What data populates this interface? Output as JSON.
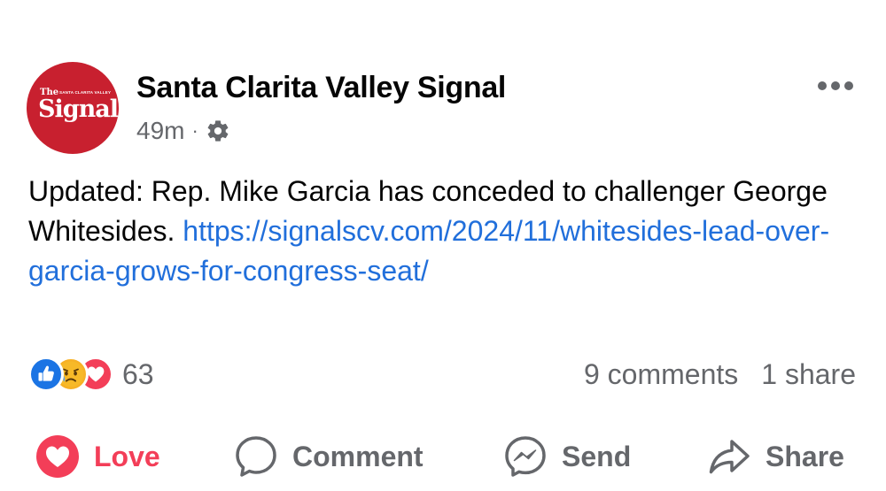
{
  "post": {
    "page_name": "Santa Clarita Valley Signal",
    "timestamp": "49m",
    "separator": "·",
    "privacy_icon": "gear-icon",
    "avatar": {
      "logo_the": "The",
      "logo_scv": "SANTA CLARITA VALLEY",
      "logo_signal": "Signal",
      "bg_color": "#c8202f"
    },
    "text": "Updated: Rep. Mike Garcia has conceded to challenger George Whitesides.",
    "link": "https://signalscv.com/2024/11/whitesides-lead-over-garcia-grows-for-congress-seat/",
    "link_color": "#216fdb"
  },
  "stats": {
    "reactions": [
      "like",
      "sad",
      "love"
    ],
    "reaction_count": "63",
    "comments": "9 comments",
    "shares": "1 share"
  },
  "actions": {
    "love": "Love",
    "comment": "Comment",
    "send": "Send",
    "share": "Share",
    "love_color": "#f33e58"
  }
}
